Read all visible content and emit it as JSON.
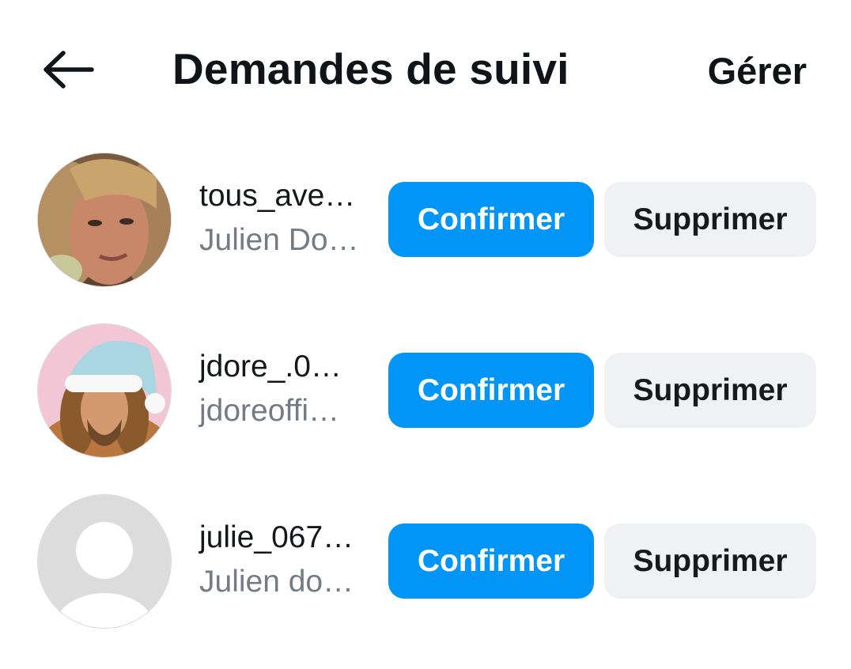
{
  "header": {
    "back_icon": "arrow-left-icon",
    "title": "Demandes de suivi",
    "manage_label": "Gérer"
  },
  "requests": [
    {
      "username": "tous_ave…",
      "full_name": "Julien Do…",
      "avatar": "photo-blond-man",
      "confirm_label": "Confirmer",
      "delete_label": "Supprimer"
    },
    {
      "username": "jdore_.0…",
      "full_name": "jdoreoffi…",
      "avatar": "photo-santa-hat-man",
      "confirm_label": "Confirmer",
      "delete_label": "Supprimer"
    },
    {
      "username": "julie_067…",
      "full_name": "Julien do…",
      "avatar": "default-avatar-icon",
      "confirm_label": "Confirmer",
      "delete_label": "Supprimer"
    }
  ],
  "colors": {
    "confirm_bg": "#0095f6",
    "delete_bg": "#f0f1f4",
    "secondary_text": "#737b84"
  }
}
